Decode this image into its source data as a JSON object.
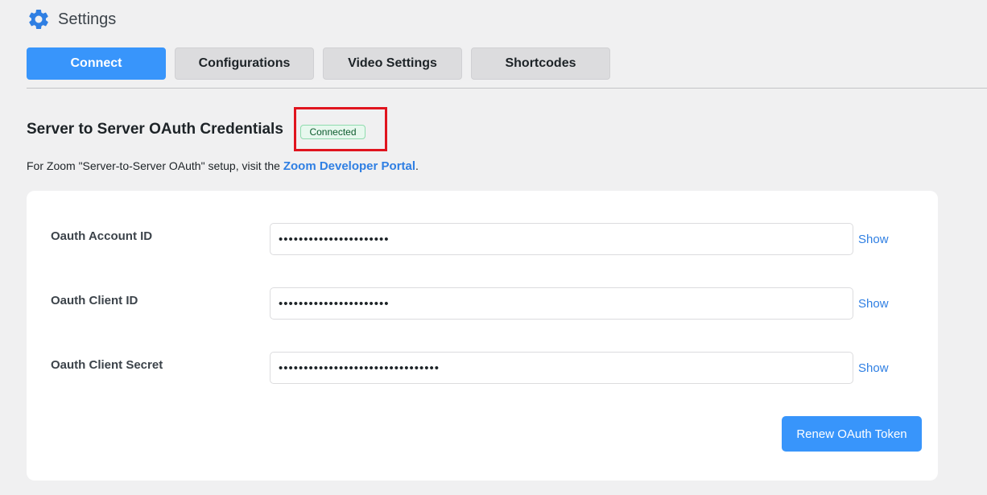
{
  "header": {
    "title": "Settings",
    "icon": "gear-icon",
    "accent": "#3895fb"
  },
  "tabs": [
    {
      "label": "Connect",
      "active": true
    },
    {
      "label": "Configurations",
      "active": false
    },
    {
      "label": "Video Settings",
      "active": false
    },
    {
      "label": "Shortcodes",
      "active": false
    }
  ],
  "section": {
    "title": "Server to Server OAuth Credentials",
    "status": "Connected",
    "intro_text": "For Zoom \"Server-to-Server OAuth\" setup, visit the ",
    "intro_link": "Zoom Developer Portal",
    "intro_suffix": "."
  },
  "fields": [
    {
      "label": "Oauth Account ID",
      "value": "••••••••••••••••••••••",
      "show": "Show"
    },
    {
      "label": "Oauth Client ID",
      "value": "••••••••••••••••••••••",
      "show": "Show"
    },
    {
      "label": "Oauth Client Secret",
      "value": "••••••••••••••••••••••••••••••••",
      "show": "Show"
    }
  ],
  "actions": {
    "renew": "Renew OAuth Token"
  }
}
